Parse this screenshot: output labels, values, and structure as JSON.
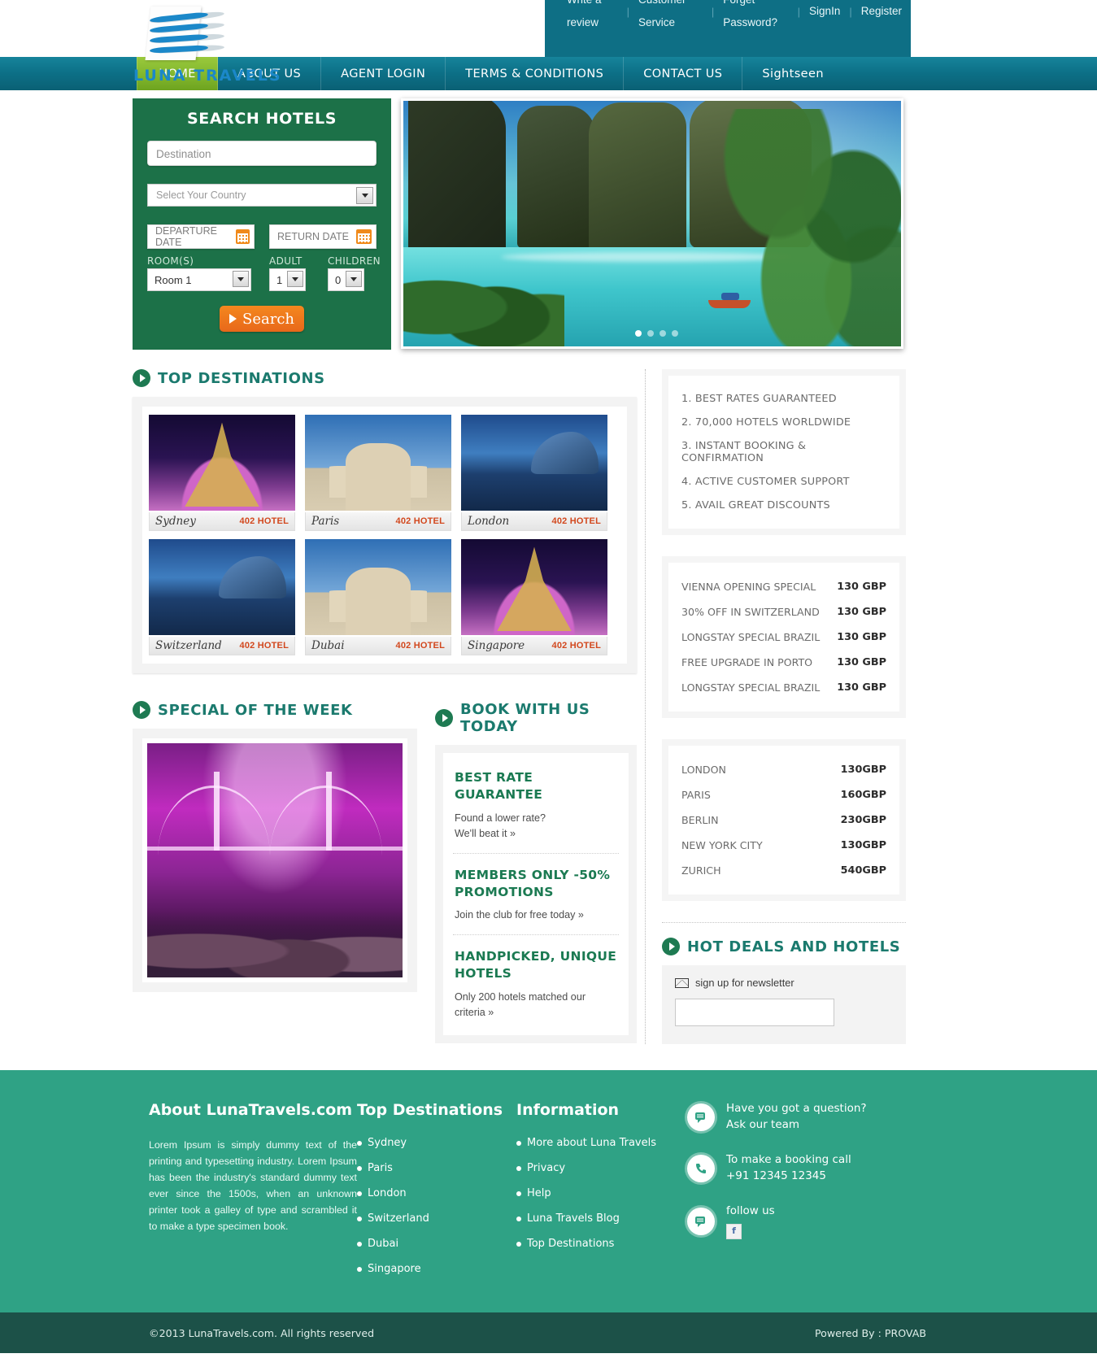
{
  "topbar": {
    "links": [
      "Write a review",
      "Customer Service",
      "Forget Password?",
      "SignIn",
      "Register"
    ],
    "bg": "#0e6f85"
  },
  "logo": {
    "text": "LUNA TRAVELS",
    "color": "#1b88c9"
  },
  "nav": {
    "items": [
      "HOME",
      "ABOUT US",
      "AGENT LOGIN",
      "TERMS & CONDITIONS",
      "CONTACT US",
      "Sightseen"
    ],
    "active": "HOME",
    "active_color": "#7fb52c",
    "bg": "#0d7188"
  },
  "search": {
    "title": "SEARCH HOTELS",
    "destination_placeholder": "Destination",
    "country_value": "Select Your Country",
    "departure_label": "DEPARTURE DATE",
    "return_label": "RETURN DATE",
    "rooms_label": "ROOM(S)",
    "rooms_value": "Room 1",
    "adult_label": "ADULT",
    "adult_value": "1",
    "children_label": "CHILDREN",
    "children_value": "0",
    "button": "Search",
    "panel_bg": "#1c7148",
    "button_color": "#ee7b1c"
  },
  "top_destinations": {
    "heading": "TOP DESTINATIONS",
    "cards": [
      {
        "name": "Sydney",
        "count": "402 HOTEL",
        "img": "eiffel"
      },
      {
        "name": "Paris",
        "count": "402 HOTEL",
        "img": "mosque"
      },
      {
        "name": "London",
        "count": "402 HOTEL",
        "img": "london"
      },
      {
        "name": "Switzerland",
        "count": "402 HOTEL",
        "img": "london"
      },
      {
        "name": "Dubai",
        "count": "402 HOTEL",
        "img": "mosque"
      },
      {
        "name": "Singapore",
        "count": "402 HOTEL",
        "img": "eiffel"
      }
    ]
  },
  "benefits": [
    "1. BEST RATES GUARANTEED",
    "2. 70,000 HOTELS WORLDWIDE",
    "3. INSTANT BOOKING & CONFIRMATION",
    "4. ACTIVE CUSTOMER SUPPORT",
    "5. AVAIL GREAT DISCOUNTS"
  ],
  "offers": [
    {
      "name": "VIENNA OPENING SPECIAL",
      "price": "130 GBP"
    },
    {
      "name": "30% OFF IN SWITZERLAND",
      "price": "130 GBP"
    },
    {
      "name": "LONGSTAY SPECIAL BRAZIL",
      "price": "130 GBP"
    },
    {
      "name": "FREE UPGRADE IN PORTO",
      "price": "130 GBP"
    },
    {
      "name": "LONGSTAY SPECIAL BRAZIL",
      "price": "130 GBP"
    }
  ],
  "city_prices": [
    {
      "city": "LONDON",
      "price": "130GBP"
    },
    {
      "city": "PARIS",
      "price": "160GBP"
    },
    {
      "city": "BERLIN",
      "price": "230GBP"
    },
    {
      "city": "NEW YORK CITY",
      "price": "130GBP"
    },
    {
      "city": "ZURICH",
      "price": "540GBP"
    }
  ],
  "special": {
    "heading": "SPECIAL OF THE WEEK"
  },
  "book_with_us": {
    "heading": "BOOK WITH US TODAY",
    "items": [
      {
        "title": "BEST RATE GUARANTEE",
        "body": "Found a lower rate?\nWe'll beat it »"
      },
      {
        "title": "MEMBERS ONLY -50% PROMOTIONS",
        "body": "Join the club for free today »"
      },
      {
        "title": "HANDPICKED, UNIQUE HOTELS",
        "body": "Only 200 hotels matched our criteria »"
      }
    ]
  },
  "hot_deals": {
    "heading": "HOT DEALS AND HOTELS",
    "newsletter_label": "sign up for newsletter",
    "newsletter_value": ""
  },
  "footer": {
    "about_title": "About LunaTravels.com",
    "about_text": "Lorem Ipsum is simply dummy text of the printing and typesetting industry. Lorem Ipsum has been the industry's standard dummy text ever since the 1500s, when an unknown printer took a galley of type and scrambled it to make a type specimen book.",
    "destinations_title": "Top Destinations",
    "destinations": [
      "Sydney",
      "Paris",
      "London",
      "Switzerland",
      "Dubai",
      "Singapore"
    ],
    "information_title": "Information",
    "information": [
      "More about Luna Travels",
      "Privacy",
      "Help",
      "Luna Travels Blog",
      "Top Destinations"
    ],
    "contact": [
      {
        "icon": "chat-icon",
        "line1": "Have you got a question?",
        "line2": "Ask our team"
      },
      {
        "icon": "phone-icon",
        "line1": "To make a booking call",
        "line2": "+91 12345 12345"
      },
      {
        "icon": "chat-icon",
        "line1": "follow us",
        "line2": ""
      }
    ],
    "facebook_glyph": "f",
    "bg": "#2fa285"
  },
  "bottombar": {
    "copyright": "©2013 LunaTravels.com. All rights reserved",
    "powered": "Powered By : PROVAB",
    "bg": "#1c5148"
  }
}
